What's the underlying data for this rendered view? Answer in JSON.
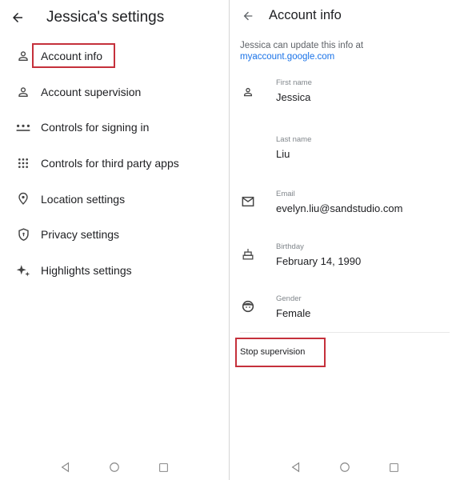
{
  "left": {
    "title": "Jessica's settings",
    "back_icon": "arrow-back-icon",
    "menu": [
      {
        "label": "Account info",
        "icon": "person-icon"
      },
      {
        "label": "Account supervision",
        "icon": "person-icon"
      },
      {
        "label": "Controls for signing in",
        "icon": "password-dots-icon"
      },
      {
        "label": "Controls for third party apps",
        "icon": "apps-grid-icon"
      },
      {
        "label": "Location settings",
        "icon": "location-pin-icon"
      },
      {
        "label": "Privacy settings",
        "icon": "shield-lock-icon"
      },
      {
        "label": "Highlights settings",
        "icon": "sparkle-icon"
      }
    ],
    "highlighted_item": "Account info"
  },
  "right": {
    "title": "Account info",
    "back_icon": "arrow-back-icon",
    "notice_text": "Jessica can update this info at",
    "notice_link": "myaccount.google.com",
    "fields": [
      {
        "label": "First name",
        "value": "Jessica",
        "icon": "person-icon"
      },
      {
        "label": "Last name",
        "value": "Liu",
        "icon": ""
      },
      {
        "label": "Email",
        "value": "evelyn.liu@sandstudio.com",
        "icon": "mail-icon"
      },
      {
        "label": "Birthday",
        "value": "February 14, 1990",
        "icon": "cake-icon"
      },
      {
        "label": "Gender",
        "value": "Female",
        "icon": "face-icon"
      }
    ],
    "stop_supervision_label": "Stop supervision",
    "highlighted_item": "Stop supervision"
  },
  "navbar": {
    "back": "nav-back-triangle-icon",
    "home": "nav-home-circle-icon",
    "recents": "nav-recents-square-icon"
  },
  "colors": {
    "highlight": "#c5303b",
    "link": "#1a73e8",
    "text_primary": "#202124",
    "text_secondary": "#5f6368"
  }
}
